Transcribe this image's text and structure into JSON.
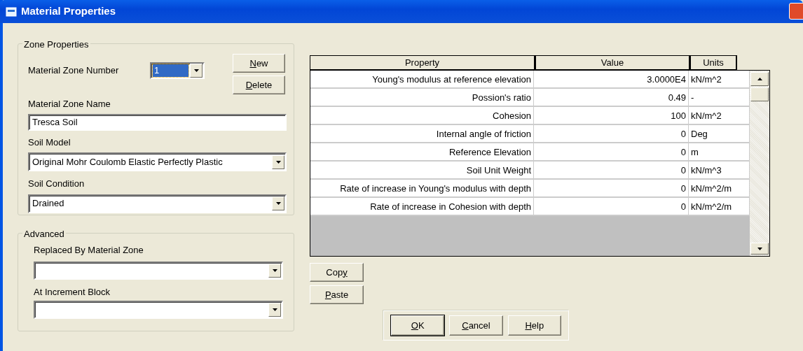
{
  "window": {
    "title": "Material Properties"
  },
  "zone_properties": {
    "title": "Zone Properties",
    "number": {
      "label": "Material Zone Number",
      "value": "1",
      "highlighted": true
    },
    "buttons": [
      {
        "label": [
          {
            "text": "N",
            "underlined": true
          },
          {
            "text": "ew",
            "underlined": false
          }
        ]
      },
      {
        "label": [
          {
            "text": "D",
            "underlined": true
          },
          {
            "text": "elete",
            "underlined": false
          }
        ]
      }
    ],
    "name": {
      "label": "Material Zone Name",
      "value": "Tresca Soil"
    },
    "soil_model": {
      "label": "Soil Model",
      "value": "Original Mohr Coulomb Elastic Perfectly Plastic"
    },
    "soil_condition": {
      "label": "Soil Condition",
      "value": "Drained"
    }
  },
  "advanced": {
    "title": "Advanced",
    "replaced_by": {
      "label": "Replaced By Material Zone"
    },
    "at_increment": {
      "label": "At Increment Block"
    }
  },
  "table": {
    "columns": [
      "Property",
      "Value",
      "Units"
    ],
    "rows": [
      {
        "property": "Young's modulus at reference elevation",
        "value": "3.0000E4",
        "units": "kN/m^2"
      },
      {
        "property": "Possion's ratio",
        "value": "0.49",
        "units": "-"
      },
      {
        "property": "Cohesion",
        "value": "100",
        "units": "kN/m^2"
      },
      {
        "property": "Internal angle of friction",
        "value": "0",
        "units": "Deg"
      },
      {
        "property": "Reference Elevation",
        "value": "0",
        "units": "m"
      },
      {
        "property": "Soil Unit Weight",
        "value": "0",
        "units": "kN/m^3"
      },
      {
        "property": "Rate of increase in Young's modulus with depth",
        "value": "0",
        "units": "kN/m^2/m"
      },
      {
        "property": "Rate of increase in Cohesion with depth",
        "value": "0",
        "units": "kN/m^2/m"
      }
    ]
  },
  "table_buttons": [
    {
      "label": [
        {
          "text": "Cop",
          "underlined": false
        },
        {
          "text": "y",
          "underlined": true
        }
      ]
    },
    {
      "label": [
        {
          "text": "P",
          "underlined": true
        },
        {
          "text": "aste",
          "underlined": false
        }
      ]
    }
  ],
  "dialog_buttons": [
    {
      "label": [
        {
          "text": "O",
          "underlined": true
        },
        {
          "text": "K",
          "underlined": false
        }
      ],
      "default": true
    },
    {
      "label": [
        {
          "text": "C",
          "underlined": true
        },
        {
          "text": "ancel",
          "underlined": false
        }
      ],
      "default": false
    },
    {
      "label": [
        {
          "text": "H",
          "underlined": true
        },
        {
          "text": "elp",
          "underlined": false
        }
      ],
      "default": false
    }
  ]
}
